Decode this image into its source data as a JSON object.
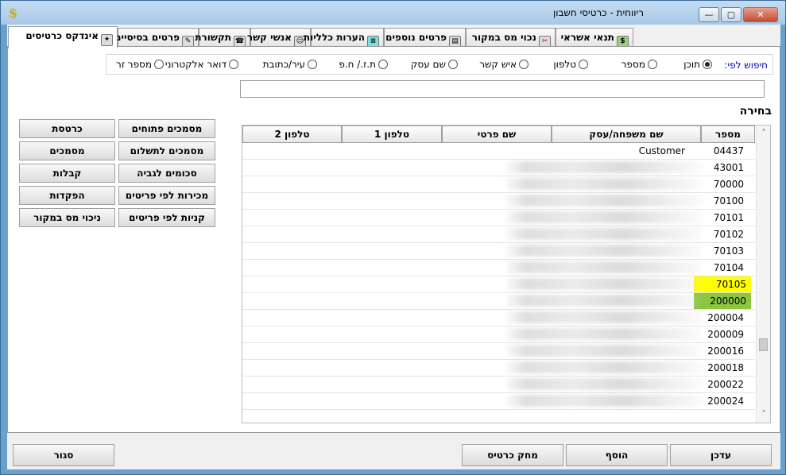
{
  "window": {
    "title": "ריווחית - כרטיסי חשבון",
    "app_icon_glyph": "$",
    "controls": {
      "minimize": "—",
      "maximize": "▢",
      "close": "✕"
    }
  },
  "tabs": [
    {
      "label": "אינדקס כרטיסים",
      "icon": "index-cards-icon",
      "active": true
    },
    {
      "label": "פרטים בסיסיים",
      "icon": "basic-details-icon"
    },
    {
      "label": "תקשורת",
      "icon": "telephone-icon"
    },
    {
      "label": "אנשי קשר",
      "icon": "contacts-icon"
    },
    {
      "label": "הערות כלליות",
      "icon": "notes-icon"
    },
    {
      "label": "פרטים נוספים",
      "icon": "more-details-icon"
    },
    {
      "label": "נכוי מס במקור",
      "icon": "tax-deduction-icon"
    },
    {
      "label": "תנאי אשראי",
      "icon": "money-bag-icon"
    }
  ],
  "search": {
    "label": "חיפוש לפי:",
    "options": [
      {
        "label": "תוכן",
        "selected": true
      },
      {
        "label": "מספר"
      },
      {
        "label": "טלפון"
      },
      {
        "label": "איש קשר"
      },
      {
        "label": "שם עסק"
      },
      {
        "label": "ת.ז./ ח.פ"
      },
      {
        "label": "עיר/כתובת"
      },
      {
        "label": "דואר אלקטרוני"
      },
      {
        "label": "מספר זר"
      }
    ],
    "input_value": ""
  },
  "grid": {
    "title": "בחירה",
    "columns": [
      "מספר",
      "שם משפחה/עסק",
      "שם פרטי",
      "טלפון 1",
      "טלפון 2"
    ],
    "rows": [
      {
        "number": "04437",
        "name": "Customer"
      },
      {
        "number": "43001",
        "name": ""
      },
      {
        "number": "70000",
        "name": ""
      },
      {
        "number": "70100",
        "name": ""
      },
      {
        "number": "70101",
        "name": ""
      },
      {
        "number": "70102",
        "name": ""
      },
      {
        "number": "70103",
        "name": ""
      },
      {
        "number": "70104",
        "name": ""
      },
      {
        "number": "70105",
        "name": "",
        "highlight": "#ffff00"
      },
      {
        "number": "200000",
        "name": "",
        "highlight": "#8cc63f"
      },
      {
        "number": "200004",
        "name": ""
      },
      {
        "number": "200009",
        "name": ""
      },
      {
        "number": "200016",
        "name": ""
      },
      {
        "number": "200018",
        "name": ""
      },
      {
        "number": "200022",
        "name": ""
      },
      {
        "number": "200024",
        "name": ""
      }
    ],
    "scroll_up": "˄",
    "scroll_down": "˅"
  },
  "side_buttons": {
    "right_column": [
      "מסמכים פתוחים",
      "מסמכים לתשלום",
      "סכומים לגביה",
      "מכירות לפי פריטים",
      "קניות לפי פריטים"
    ],
    "left_column": [
      "כרטסת",
      "מסמכים",
      "קבלות",
      "הפקדות",
      "ניכוי מס במקור"
    ]
  },
  "bottom_buttons": {
    "update": "עדכן",
    "add": "הוסף",
    "delete_card": "מחק כרטיס",
    "close": "סגור"
  }
}
